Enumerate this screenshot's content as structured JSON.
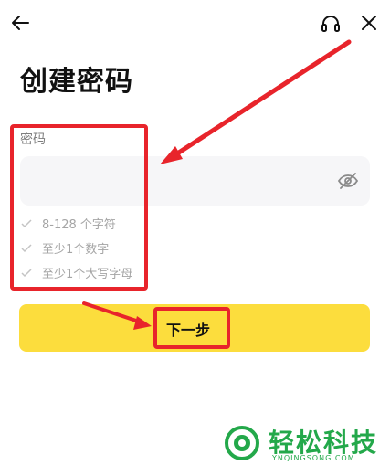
{
  "header": {
    "back_icon": "arrow-left-icon",
    "support_icon": "headset-icon",
    "close_icon": "close-icon"
  },
  "title": "创建密码",
  "password": {
    "label": "密码",
    "value": "",
    "visibility_icon": "eye-off-icon"
  },
  "requirements": [
    {
      "text": "8-128 个字符",
      "met": false
    },
    {
      "text": "至少1个数字",
      "met": false
    },
    {
      "text": "至少1个大写字母",
      "met": false
    }
  ],
  "next_button": {
    "label": "下一步"
  },
  "watermark": {
    "name": "轻松科技",
    "site": "YNQINGSONG.COM"
  },
  "colors": {
    "accent_yellow": "#fcdd3d",
    "annotation_red": "#e8242b",
    "input_bg": "#f6f6f8",
    "watermark_green": "#23a84a"
  }
}
